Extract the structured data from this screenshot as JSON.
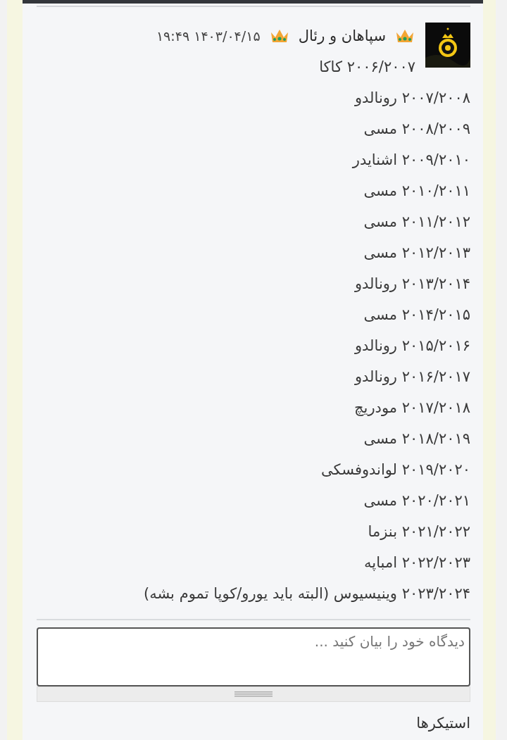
{
  "post": {
    "author": "سپاهان و رئال",
    "date": "۱۴۰۳/۰۴/۱۵ ۱۹:۴۹",
    "lines": [
      "۲۰۰۶/۲۰۰۷ کاکا",
      "۲۰۰۷/۲۰۰۸ رونالدو",
      "۲۰۰۸/۲۰۰۹ مسی",
      "۲۰۰۹/۲۰۱۰ اشنایدر",
      "۲۰۱۰/۲۰۱۱ مسی",
      "۲۰۱۱/۲۰۱۲ مسی",
      "۲۰۱۲/۲۰۱۳ مسی",
      "۲۰۱۳/۲۰۱۴ رونالدو",
      "۲۰۱۴/۲۰۱۵ مسی",
      "۲۰۱۵/۲۰۱۶ رونالدو",
      "۲۰۱۶/۲۰۱۷ رونالدو",
      "۲۰۱۷/۲۰۱۸ مودریچ",
      "۲۰۱۸/۲۰۱۹ مسی",
      "۲۰۱۹/۲۰۲۰ لواندوفسکی",
      "۲۰۲۰/۲۰۲۱ مسی",
      "۲۰۲۱/۲۰۲۲ بنزما",
      "۲۰۲۲/۲۰۲۳ امباپه",
      "۲۰۲۳/۲۰۲۴ وینیسیوس (البته باید یورو/کوپا تموم بشه)"
    ]
  },
  "comment": {
    "placeholder": "دیدگاه خود را بیان کنید ..."
  },
  "stickers": {
    "title": "استیکرها"
  }
}
